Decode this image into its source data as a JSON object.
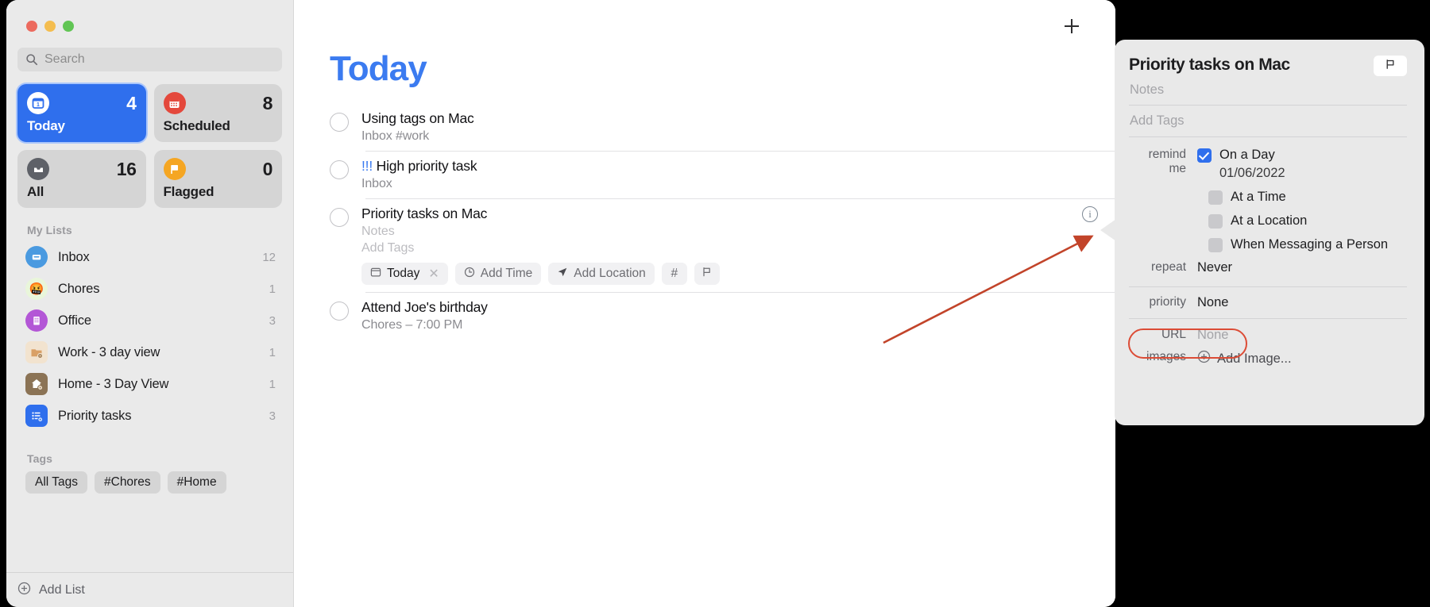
{
  "window": {
    "traffic_lights": [
      "close",
      "minimize",
      "zoom"
    ]
  },
  "sidebar": {
    "search": {
      "placeholder": "Search",
      "value": ""
    },
    "cards": [
      {
        "label": "Today",
        "count": "4",
        "icon": "calendar-day-icon",
        "active": true
      },
      {
        "label": "Scheduled",
        "count": "8",
        "icon": "calendar-icon",
        "active": false
      },
      {
        "label": "All",
        "count": "16",
        "icon": "inbox-tray-icon",
        "active": false
      },
      {
        "label": "Flagged",
        "count": "0",
        "icon": "flag-icon",
        "active": false
      }
    ],
    "my_lists_header": "My Lists",
    "lists": [
      {
        "name": "Inbox",
        "count": "12",
        "icon": "inbox-icon",
        "color": "#4a9ae0"
      },
      {
        "name": "Chores",
        "count": "1",
        "icon": "emoji-face-icon",
        "color": "#e8f5d8"
      },
      {
        "name": "Office",
        "count": "3",
        "icon": "office-building-icon",
        "color": "#b356d6"
      },
      {
        "name": "Work - 3 day view",
        "count": "1",
        "icon": "folder-smart-list-icon",
        "color": "#f0e0cc"
      },
      {
        "name": "Home - 3 Day View",
        "count": "1",
        "icon": "house-smart-list-icon",
        "color": "#8b7355"
      },
      {
        "name": "Priority tasks",
        "count": "3",
        "icon": "list-smart-list-icon",
        "color": "#2f6fed"
      }
    ],
    "tags_header": "Tags",
    "tags": [
      "All Tags",
      "#Chores",
      "#Home"
    ],
    "add_list_label": "Add List"
  },
  "main": {
    "title": "Today",
    "add_button": "+",
    "tasks": [
      {
        "title": "Using tags on Mac",
        "subtitle": "Inbox",
        "tag": "#work",
        "priority_marks": "",
        "selected": false
      },
      {
        "title": "High priority task",
        "subtitle": "Inbox",
        "tag": "",
        "priority_marks": "!!!",
        "selected": false
      },
      {
        "title": "Priority tasks on Mac",
        "subtitle": "",
        "notes_placeholder": "Notes",
        "tags_placeholder": "Add Tags",
        "tag": "",
        "priority_marks": "",
        "selected": true,
        "chips": [
          {
            "label": "Today",
            "icon": "calendar-icon",
            "removable": true,
            "filled": true
          },
          {
            "label": "Add Time",
            "icon": "clock-icon",
            "removable": false,
            "filled": false
          },
          {
            "label": "Add Location",
            "icon": "location-arrow-icon",
            "removable": false,
            "filled": false
          },
          {
            "label": "#",
            "icon": "hash-icon",
            "removable": false,
            "filled": false,
            "square": true
          },
          {
            "label": "",
            "icon": "flag-outline-icon",
            "removable": false,
            "filled": false,
            "square": true
          }
        ],
        "info_icon": "info-circle-icon"
      },
      {
        "title": "Attend Joe's birthday",
        "subtitle": "Chores – 7:00 PM",
        "tag": "",
        "priority_marks": "",
        "selected": false
      }
    ]
  },
  "popover": {
    "title": "Priority tasks on Mac",
    "flag_button_icon": "flag-outline-icon",
    "notes_placeholder": "Notes",
    "tags_placeholder": "Add Tags",
    "remind_me_label": "remind me",
    "remind_options": [
      {
        "label": "On a Day",
        "checked": true,
        "sub_value": "01/06/2022"
      },
      {
        "label": "At a Time",
        "checked": false,
        "sub_value": ""
      },
      {
        "label": "At a Location",
        "checked": false,
        "sub_value": ""
      },
      {
        "label": "When Messaging a Person",
        "checked": false,
        "sub_value": ""
      }
    ],
    "repeat_label": "repeat",
    "repeat_value": "Never",
    "priority_label": "priority",
    "priority_value": "None",
    "url_label": "URL",
    "url_value": "None",
    "images_label": "images",
    "add_image_label": "Add Image..."
  },
  "annotations": {
    "highlight_color": "#dc4c36",
    "arrow_color": "#c2442a",
    "arrow_target": "info-circle-icon",
    "highlight_target": "priority-row"
  },
  "colors": {
    "accent_blue": "#2f6fed",
    "title_blue": "#3b7bf0",
    "sidebar_bg": "#eaeaea",
    "popover_bg": "#e9e9e9",
    "annotation_red": "#dc4c36"
  }
}
